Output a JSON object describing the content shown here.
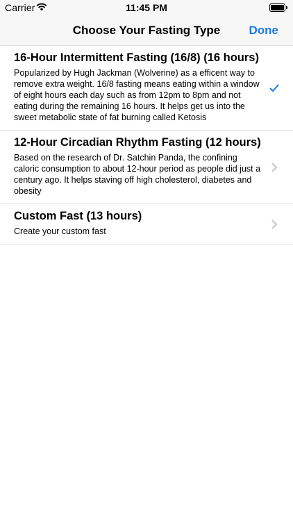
{
  "status_bar": {
    "carrier": "Carrier",
    "time": "11:45 PM"
  },
  "nav": {
    "title": "Choose Your Fasting Type",
    "done_label": "Done",
    "accent_color": "#1a7ae0"
  },
  "options": [
    {
      "title": "16-Hour Intermittent Fasting (16/8) (16 hours)",
      "description": "Popularized by Hugh Jackman (Wolverine) as a efficent way to remove extra weight. 16/8 fasting means eating within a window of eight hours each day such as from 12pm to 8pm and not eating during the remaining 16 hours. It helps get us into the sweet metabolic state of fat burning called Ketosis",
      "accessory": "checkmark-icon",
      "selected": true
    },
    {
      "title": "12-Hour Circadian Rhythm Fasting (12 hours)",
      "description": "Based on the research of Dr. Satchin Panda, the confining caloric consumption to about 12-hour period as people did just a century ago. It helps staving off high cholesterol, diabetes and obesity",
      "accessory": "chevron-right-icon",
      "selected": false
    },
    {
      "title": "Custom Fast (13 hours)",
      "description": "Create your custom fast",
      "accessory": "chevron-right-icon",
      "selected": false
    }
  ]
}
